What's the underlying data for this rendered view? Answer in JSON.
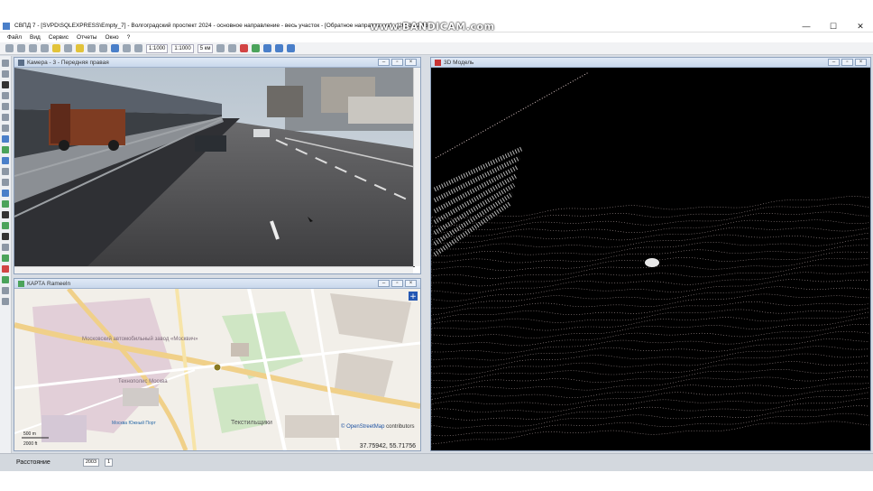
{
  "watermark": "www.BANDICAM.com",
  "window": {
    "title": "СВПД 7 - [SVPD\\SQLEXPRESS\\Empty_7] - Волгоградский проспект 2024 - основное направление - весь участок - [Обратное направление] - [2023.02.15]",
    "minimize": "—",
    "maximize": "☐",
    "close": "✕"
  },
  "menu": [
    "Файл",
    "Вид",
    "Сервис",
    "Отчеты",
    "Окно",
    "?"
  ],
  "toolbar": {
    "scale1": "1:1000",
    "scale2": "1:1000",
    "distance": "5 км"
  },
  "camera": {
    "title": "Камера - 3 - Передняя правая"
  },
  "map": {
    "title": "КАРТА Rameeln",
    "area_label": "Московский автомобильный завод «Москвич»",
    "park_label": "Технополис Москва",
    "district_label": "Текстильщики",
    "port_label": "Москва Южный Порт",
    "attribution_link": "© OpenStreetMap",
    "attribution_text": " contributors",
    "scale_top": "500 m",
    "scale_bottom": "2000 ft",
    "coords": "37.75942, 55.71756"
  },
  "model3d": {
    "title": "3D Модель"
  },
  "status": {
    "label": "Расстояние",
    "value": "2003",
    "value2": "1"
  },
  "colors": {
    "accent": "#4a7fc9",
    "cloud_point": "#d8c2c2",
    "map_bg": "#f2efe9"
  }
}
